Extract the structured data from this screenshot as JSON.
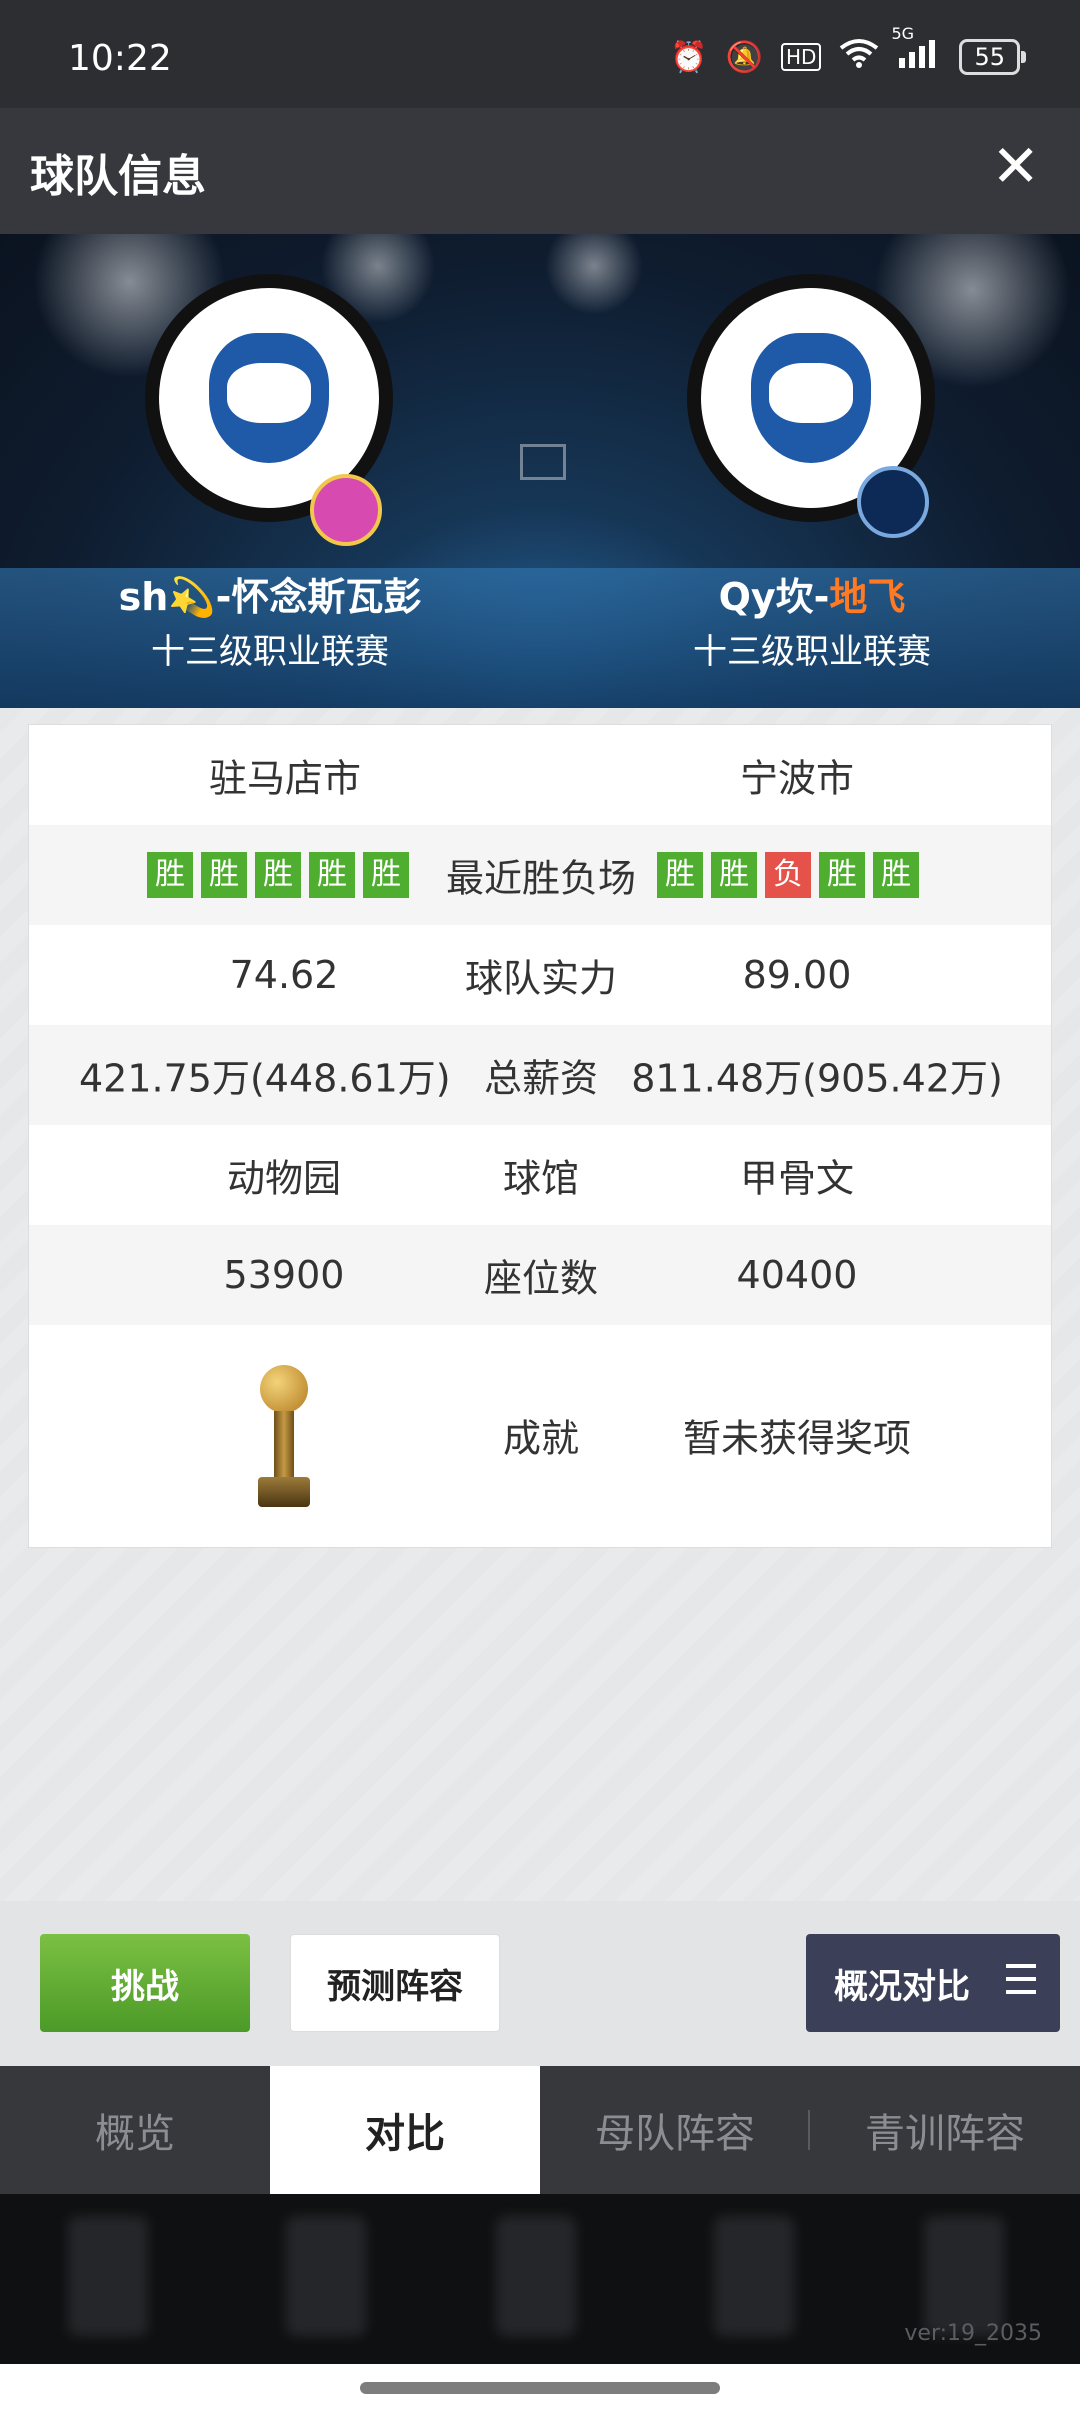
{
  "status_bar": {
    "time": "10:22",
    "icons": [
      "alarm-icon",
      "mute-icon",
      "hd-icon",
      "wifi-icon",
      "signal-5g-icon",
      "battery-icon"
    ],
    "hd": "HD",
    "network": "5G",
    "battery": "55"
  },
  "header": {
    "title": "球队信息",
    "close": "✕"
  },
  "teams": {
    "left": {
      "name_prefix": "sh💫-怀念斯瓦彭",
      "name_highlight": "",
      "league": "十三级职业联赛"
    },
    "right": {
      "name_prefix": "Qy坎-",
      "name_highlight": "地飞",
      "league": "十三级职业联赛"
    }
  },
  "compare": {
    "city": {
      "left": "驻马店市",
      "right": "宁波市"
    },
    "recent": {
      "label": "最近胜负场",
      "left": [
        "胜",
        "胜",
        "胜",
        "胜",
        "胜"
      ],
      "right": [
        "胜",
        "胜",
        "负",
        "胜",
        "胜"
      ]
    },
    "strength": {
      "label": "球队实力",
      "left": "74.62",
      "right": "89.00"
    },
    "salary": {
      "label": "总薪资",
      "left": "421.75万(448.61万)",
      "right": "811.48万(905.42万)"
    },
    "arena": {
      "label": "球馆",
      "left": "动物园",
      "right": "甲骨文"
    },
    "seats": {
      "label": "座位数",
      "left": "53900",
      "right": "40400"
    },
    "achievement": {
      "label": "成就",
      "right": "暂未获得奖项"
    }
  },
  "actions": {
    "challenge": "挑战",
    "predict": "预测阵容",
    "compare": "概况对比"
  },
  "tabs": [
    "概览",
    "对比",
    "母队阵容",
    "青训阵容"
  ],
  "active_tab": "对比",
  "version": "ver:19_2035",
  "colors": {
    "win": "#4fae2f",
    "loss": "#e4524a",
    "highlight": "#ff7a22",
    "challenge": "#5aa631"
  }
}
